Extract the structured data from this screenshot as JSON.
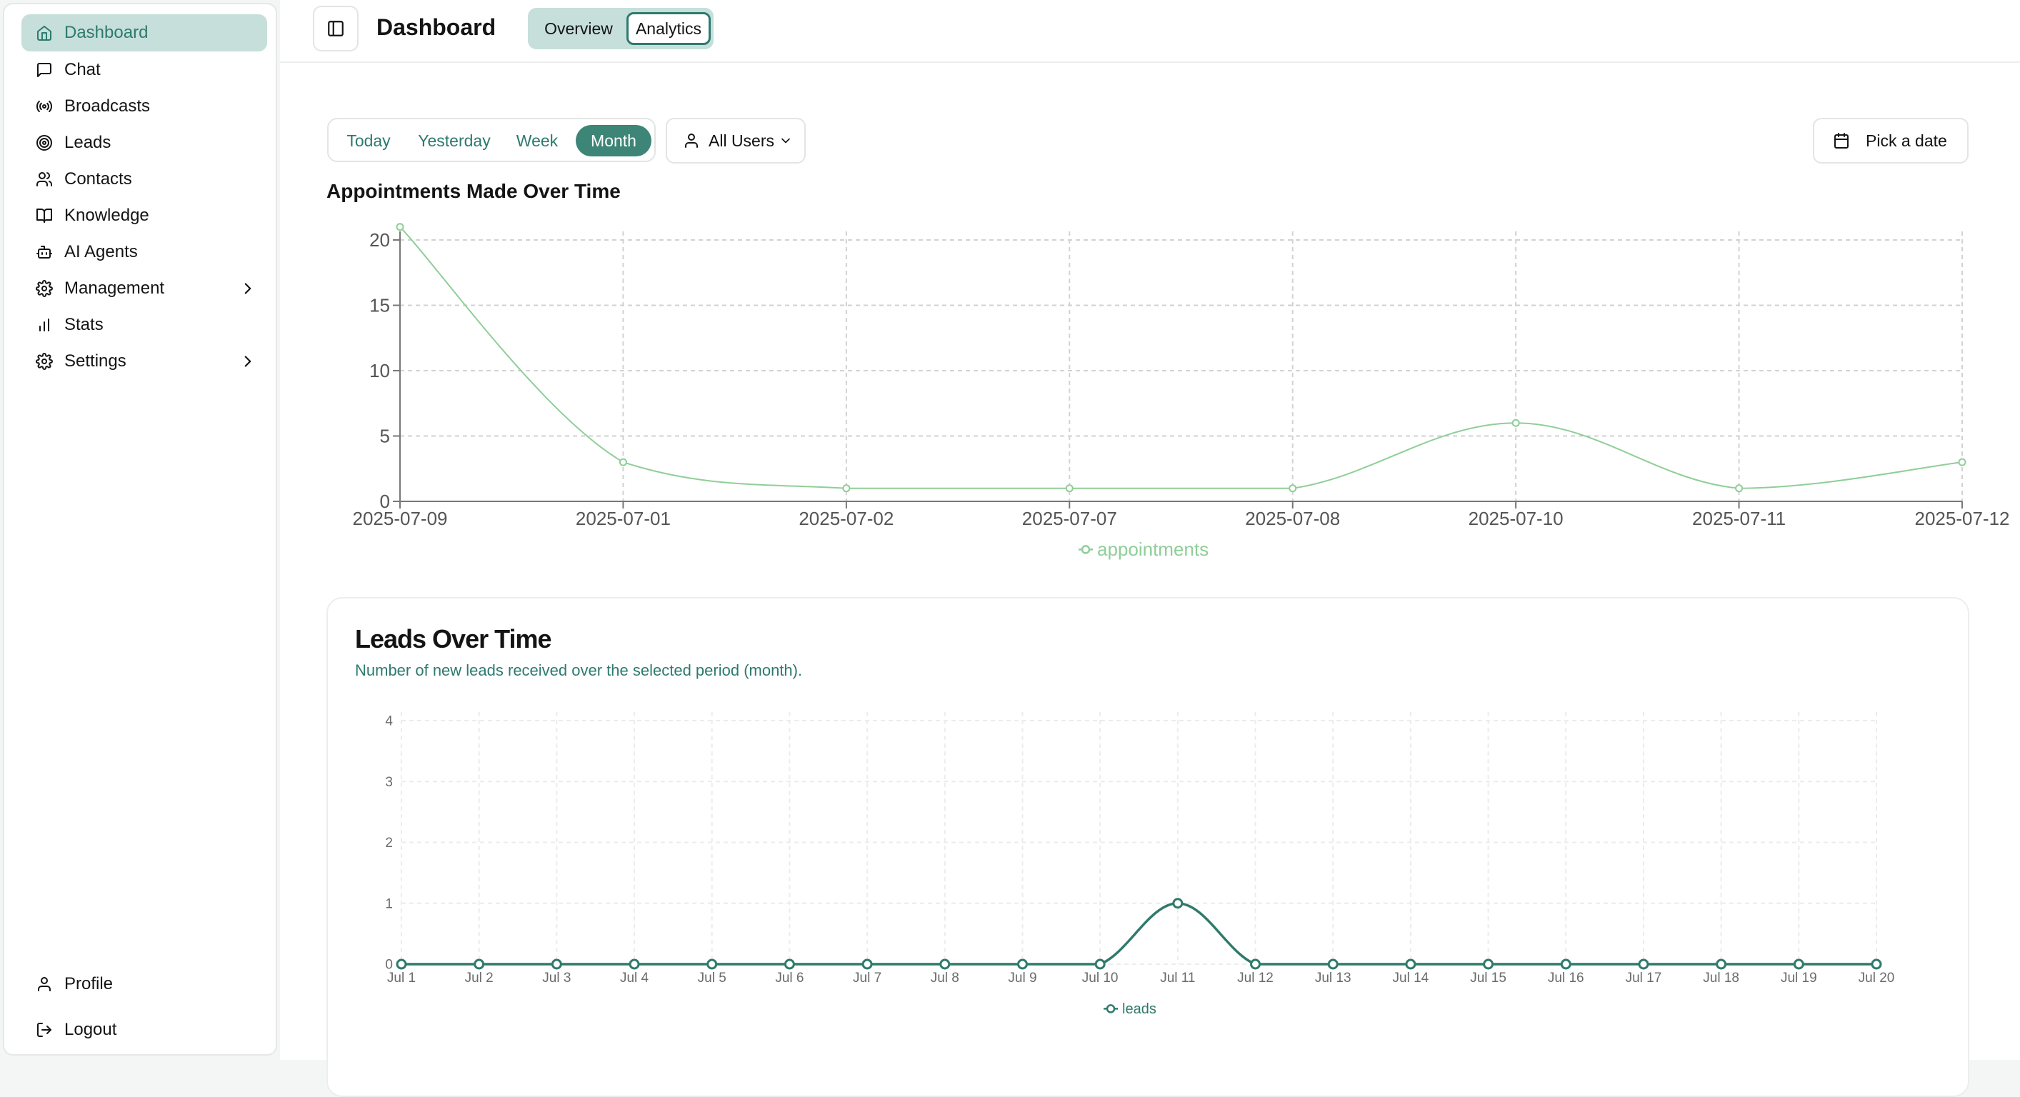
{
  "sidebar": {
    "items": [
      {
        "label": "Dashboard",
        "icon": "home-icon",
        "active": true
      },
      {
        "label": "Chat",
        "icon": "message-square-icon"
      },
      {
        "label": "Broadcasts",
        "icon": "radio-icon"
      },
      {
        "label": "Leads",
        "icon": "target-icon"
      },
      {
        "label": "Contacts",
        "icon": "users-icon"
      },
      {
        "label": "Knowledge",
        "icon": "book-open-icon"
      },
      {
        "label": "AI Agents",
        "icon": "bot-icon"
      },
      {
        "label": "Management",
        "icon": "gear-icon",
        "expandable": true
      },
      {
        "label": "Stats",
        "icon": "bar-chart-icon"
      },
      {
        "label": "Settings",
        "icon": "gear-icon",
        "expandable": true
      }
    ],
    "footer": [
      {
        "label": "Profile",
        "icon": "user-icon"
      },
      {
        "label": "Logout",
        "icon": "logout-icon"
      }
    ]
  },
  "header": {
    "title": "Dashboard",
    "tabs": [
      "Overview",
      "Analytics"
    ],
    "active_tab": "Analytics"
  },
  "filters": {
    "ranges": [
      "Today",
      "Yesterday",
      "Week",
      "Month"
    ],
    "active_range": "Month",
    "users_label": "All Users",
    "date_label": "Pick a date"
  },
  "colors": {
    "accent": "#3d8577",
    "accent_light": "#c6dfdb",
    "appointments_line": "#8fce98",
    "leads_line": "#2f7a6b"
  },
  "chart_data": [
    {
      "type": "line",
      "title": "Appointments Made Over Time",
      "x": [
        "2025-07-09",
        "2025-07-01",
        "2025-07-02",
        "2025-07-07",
        "2025-07-08",
        "2025-07-10",
        "2025-07-11",
        "2025-07-12"
      ],
      "series": [
        {
          "name": "appointments",
          "values": [
            21,
            3,
            1,
            1,
            1,
            6,
            1,
            3
          ]
        }
      ],
      "yticks": [
        0,
        5,
        10,
        15,
        20
      ],
      "ylim": [
        0,
        20
      ],
      "grid": true,
      "legend": "bottom"
    },
    {
      "type": "line",
      "title": "Leads Over Time",
      "subtitle": "Number of new leads received over the selected period (month).",
      "x": [
        "Jul 1",
        "Jul 2",
        "Jul 3",
        "Jul 4",
        "Jul 5",
        "Jul 6",
        "Jul 7",
        "Jul 8",
        "Jul 9",
        "Jul 10",
        "Jul 11",
        "Jul 12",
        "Jul 13",
        "Jul 14",
        "Jul 15",
        "Jul 16",
        "Jul 17",
        "Jul 18",
        "Jul 19",
        "Jul 20"
      ],
      "series": [
        {
          "name": "leads",
          "values": [
            0,
            0,
            0,
            0,
            0,
            0,
            0,
            0,
            0,
            0,
            1,
            0,
            0,
            0,
            0,
            0,
            0,
            0,
            0,
            0
          ]
        }
      ],
      "yticks": [
        0,
        1,
        2,
        3,
        4
      ],
      "ylim": [
        0,
        4
      ],
      "grid": true,
      "legend": "bottom"
    }
  ]
}
